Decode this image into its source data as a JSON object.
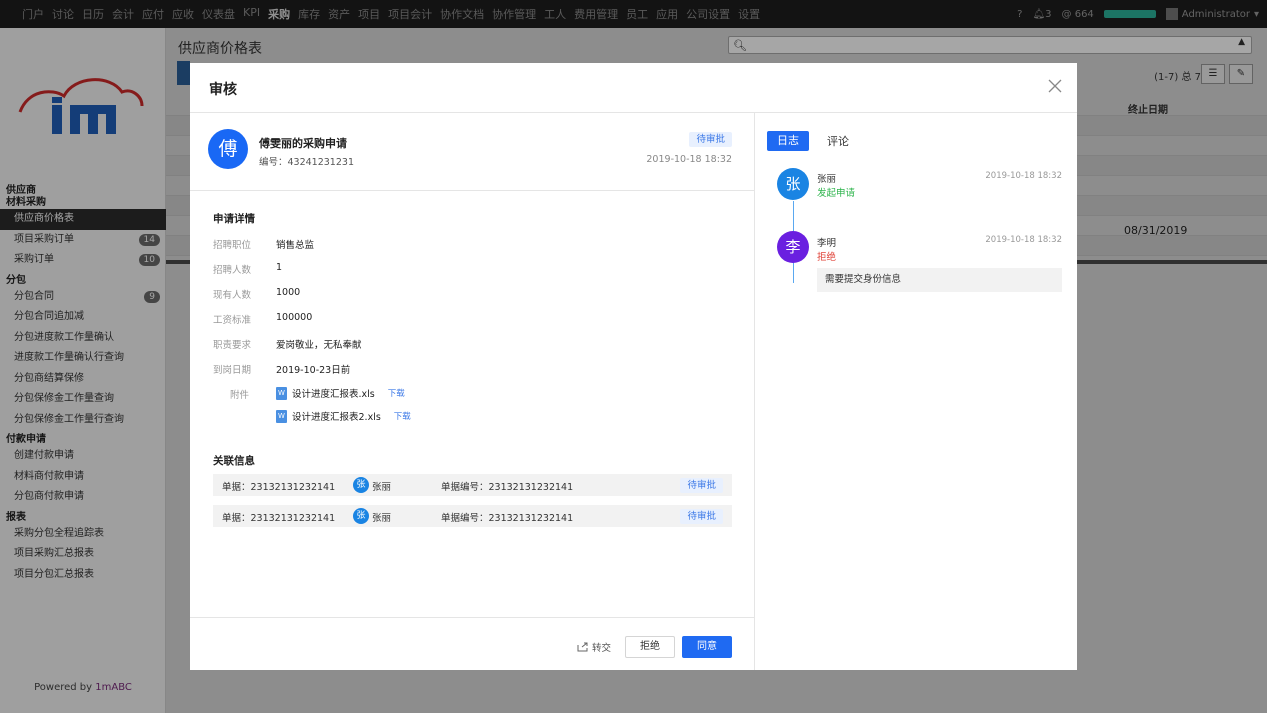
{
  "topnav": {
    "items": [
      "门户",
      "讨论",
      "日历",
      "会计",
      "应付",
      "应收",
      "仪表盘",
      "KPI",
      "采购",
      "库存",
      "资产",
      "项目",
      "项目会计",
      "协作文档",
      "协作管理",
      "工人",
      "费用管理",
      "员工",
      "应用",
      "公司设置",
      "设置"
    ],
    "active": "采购",
    "help": "?",
    "notifications": "3",
    "mentions": "664",
    "user": "Administrator"
  },
  "sidebar": {
    "groups": [
      {
        "title": "供应商",
        "items": []
      },
      {
        "title": "材料采购",
        "items": [
          {
            "label": "供应商价格表",
            "active": true
          },
          {
            "label": "项目采购订单",
            "badge": "14"
          },
          {
            "label": "采购订单",
            "badge": "10"
          }
        ]
      },
      {
        "title": "分包",
        "items": [
          {
            "label": "分包合同",
            "badge": "9"
          },
          {
            "label": "分包合同追加减"
          },
          {
            "label": "分包进度款工作量确认"
          },
          {
            "label": "进度款工作量确认行查询"
          },
          {
            "label": "分包商结算保修"
          },
          {
            "label": "分包保修金工作量查询"
          },
          {
            "label": "分包保修金工作量行查询"
          }
        ]
      },
      {
        "title": "付款申请",
        "items": [
          {
            "label": "创建付款申请"
          },
          {
            "label": "材料商付款申请"
          },
          {
            "label": "分包商付款申请"
          }
        ]
      },
      {
        "title": "报表",
        "items": [
          {
            "label": "采购分包全程追踪表"
          },
          {
            "label": "项目采购汇总报表"
          },
          {
            "label": "项目分包汇总报表"
          }
        ]
      }
    ],
    "powered_prefix": "Powered by",
    "powered_brand": "1mABC"
  },
  "background": {
    "page_title": "供应商价格表",
    "pager": "(1-7) 总 7",
    "column_header": "终止日期",
    "visible_date": "08/31/2019"
  },
  "modal": {
    "title": "审核",
    "applicant": {
      "avatar": "傅",
      "title": "傅雯丽的采购申请",
      "number": "编号：43241231231",
      "status": "待审批",
      "time": "2019-10-18  18:32"
    },
    "details": {
      "section_title": "申请详情",
      "fields": [
        {
          "label": "招聘职位",
          "value": "销售总监"
        },
        {
          "label": "招聘人数",
          "value": "1"
        },
        {
          "label": "现有人数",
          "value": "1000"
        },
        {
          "label": "工资标准",
          "value": "100000"
        },
        {
          "label": "职责要求",
          "value": "爱岗敬业，无私奉献"
        },
        {
          "label": "到岗日期",
          "value": "2019-10-23日前"
        }
      ],
      "attachments_label": "附件",
      "attachments": [
        {
          "name": "设计进度汇报表.xls",
          "action": "下载",
          "icon": "W"
        },
        {
          "name": "设计进度汇报表2.xls",
          "action": "下载",
          "icon": "W"
        }
      ]
    },
    "related": {
      "section_title": "关联信息",
      "rows": [
        {
          "doc": "单据：23132131232141",
          "avatar": "张",
          "person": "张丽",
          "doc_no": "单据编号：23132131232141",
          "status": "待审批"
        },
        {
          "doc": "单据：23132131232141",
          "avatar": "张",
          "person": "张丽",
          "doc_no": "单据编号：23132131232141",
          "status": "待审批"
        }
      ]
    },
    "footer": {
      "transfer": "转交",
      "reject": "拒绝",
      "approve": "同意"
    },
    "right": {
      "tabs": [
        "日志",
        "评论"
      ],
      "logs": [
        {
          "avatar": "张",
          "name": "张丽",
          "action": "发起申请",
          "time": "2019-10-18  18:32",
          "color": "#1a84e3",
          "action_color": "#2bb34a"
        },
        {
          "avatar": "李",
          "name": "李明",
          "action": "拒绝",
          "time": "2019-10-18  18:32",
          "color": "#6a1fe0",
          "action_color": "#e0443a",
          "note": "需要提交身份信息"
        }
      ]
    }
  },
  "colors": {
    "primary": "#1f6af2",
    "pending_tag_bg": "#e8f0fe",
    "pending_tag_text": "#3b78e7"
  }
}
